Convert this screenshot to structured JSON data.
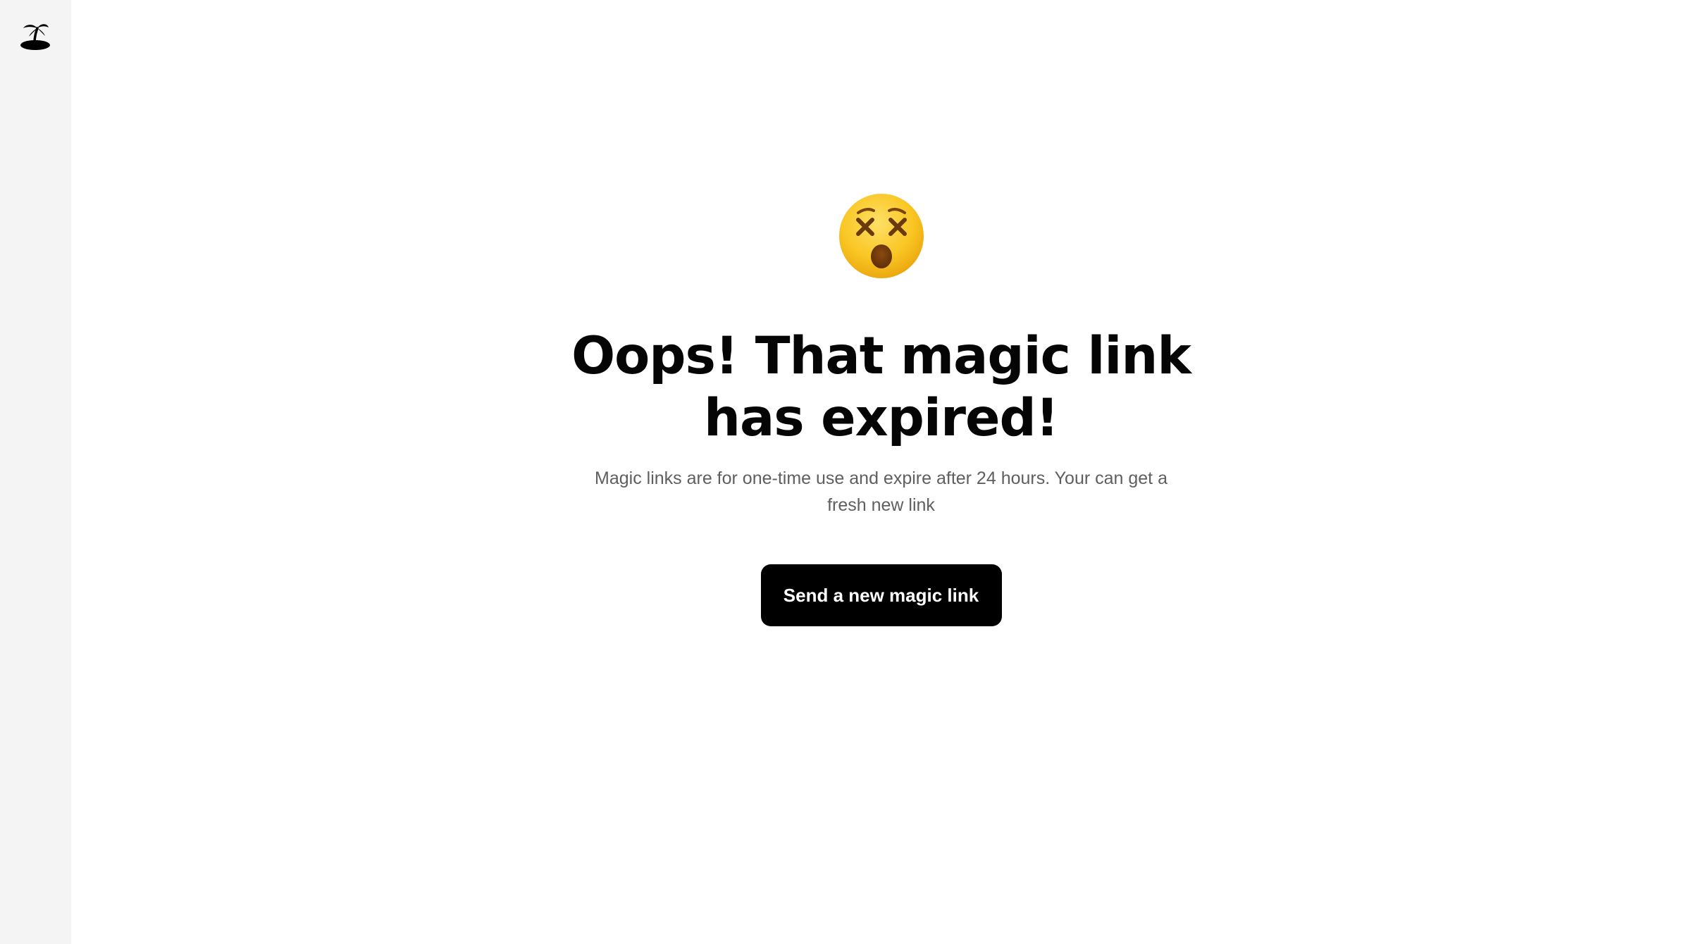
{
  "sidebar": {
    "logo_icon": "palm-tree-island-icon"
  },
  "main": {
    "emoji_icon": "dizzy-face-emoji",
    "title": "Oops! That magic link has expired!",
    "subtitle": "Magic links are for one-time use and expire after 24 hours. Your can get a fresh new link",
    "button_label": "Send a new magic link"
  },
  "colors": {
    "sidebar_bg": "#f4f4f4",
    "button_bg": "#000000",
    "button_text": "#ffffff",
    "subtitle_text": "#5f5f5f",
    "emoji_face": "#f9c623"
  }
}
